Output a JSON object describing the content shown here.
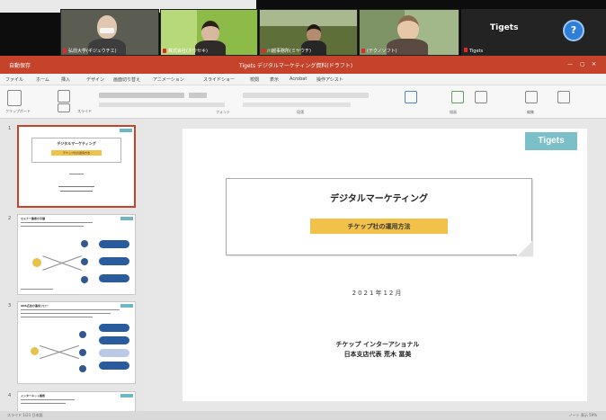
{
  "meeting": {
    "tiles": [
      {
        "caption": "弘前大学(ギジュウチエ)",
        "bg": "#5b5d52"
      },
      {
        "caption": "株式会社(ホウセキ)",
        "bg": "#8dbb48"
      },
      {
        "caption": "川越事務所(ミヤウチ)",
        "bg": "#5f6f3a"
      },
      {
        "caption": "(テクノソフト)",
        "bg": "#a3b88a"
      }
    ],
    "participant_name": "Tigets",
    "participant_caption": "Tigets",
    "avatar_letter": "?"
  },
  "app": {
    "title": "Tigets デジタルマーケティング資料(ドラフト)",
    "autosave": "自動保存",
    "window_controls": "— ◻ ✕"
  },
  "menu": [
    "ファイル",
    "ホーム",
    "挿入",
    "デザイン",
    "画面切り替え",
    "アニメーション",
    "スライドショー",
    "校閲",
    "表示",
    "Acrobat",
    "操作アシスト"
  ],
  "ribbon": {
    "groups": [
      "貼り付け",
      "クリップボード",
      "スライド",
      "フォント",
      "段落",
      "描画",
      "編集"
    ]
  },
  "thumbnails": [
    {
      "num": "1",
      "title": "デジタルマーケティング",
      "subtitle": "チケップ社の運用方法"
    },
    {
      "num": "2",
      "title": "セミナー集客の手順",
      "subtitle": ""
    },
    {
      "num": "3",
      "title": "SNS広告の運用フロー",
      "subtitle": ""
    },
    {
      "num": "4",
      "title": "インターネット集客",
      "subtitle": ""
    }
  ],
  "slide": {
    "logo": "Tigets",
    "title": "デジタルマーケティング",
    "subtitle": "チケップ社の運用方法",
    "date": "2021年12月",
    "company": "チケップ インターアショナル",
    "person": "日本支店代表 荒木 冨美"
  },
  "status": {
    "left": "スライド 1/21 日本語",
    "zoom": "ノート 表示 59%"
  }
}
